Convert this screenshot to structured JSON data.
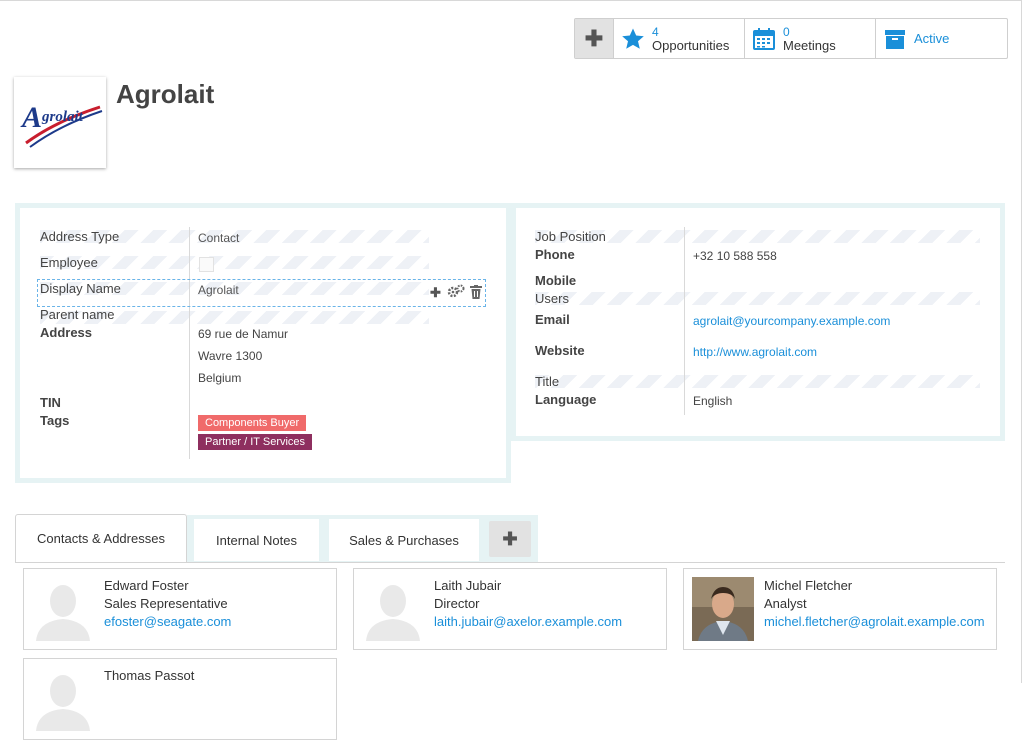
{
  "stats": {
    "opportunities": {
      "count": "4",
      "label": "Opportunities"
    },
    "meetings": {
      "count": "0",
      "label": "Meetings"
    },
    "active": {
      "label": "Active"
    }
  },
  "header": {
    "title": "Agrolait",
    "logo_text": "Agrolait"
  },
  "left_panel": {
    "address_type": {
      "label": "Address Type",
      "value": "Contact"
    },
    "employee": {
      "label": "Employee"
    },
    "display_name": {
      "label": "Display Name",
      "value": "Agrolait"
    },
    "parent_name": {
      "label": "Parent name"
    },
    "address": {
      "label": "Address",
      "line1": "69 rue de Namur",
      "line2": "Wavre 1300",
      "line3": "Belgium"
    },
    "tin": {
      "label": "TIN"
    },
    "tags": {
      "label": "Tags",
      "items": [
        "Components Buyer",
        "Partner / IT Services"
      ]
    }
  },
  "right_panel": {
    "job_position": {
      "label": "Job Position"
    },
    "phone": {
      "label": "Phone",
      "value": "+32 10 588 558"
    },
    "mobile": {
      "label": "Mobile"
    },
    "users": {
      "label": "Users"
    },
    "email": {
      "label": "Email",
      "value": "agrolait@yourcompany.example.com"
    },
    "website": {
      "label": "Website",
      "value": "http://www.agrolait.com"
    },
    "title": {
      "label": "Title"
    },
    "language": {
      "label": "Language",
      "value": "English"
    }
  },
  "tabs": [
    "Contacts & Addresses",
    "Internal Notes",
    "Sales & Purchases"
  ],
  "contacts": [
    {
      "name": "Edward Foster",
      "role": "Sales Representative",
      "email": "efoster@seagate.com"
    },
    {
      "name": "Laith Jubair",
      "role": "Director",
      "email": "laith.jubair@axelor.example.com"
    },
    {
      "name": "Michel Fletcher",
      "role": "Analyst",
      "email": "michel.fletcher@agrolait.example.com"
    },
    {
      "name": "Thomas Passot",
      "role": "",
      "email": ""
    }
  ],
  "colors": {
    "accent": "#1a8fd9",
    "tag_buyer": "#f06a6a",
    "tag_partner": "#8e2f5f",
    "panel_border": "#e6f3f4"
  }
}
